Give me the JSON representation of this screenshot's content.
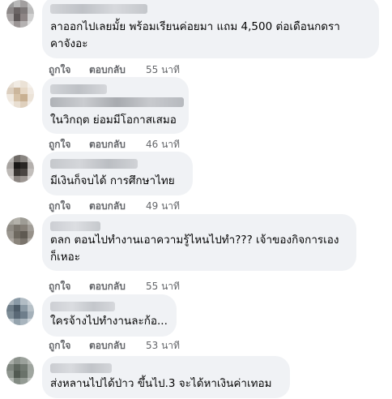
{
  "comments": [
    {
      "text_lines": [
        "ลาออกไปเลยมั้ย พร้อมเรียนค่อยมา แถม 4,500 ต่อเดือนกดรา",
        "คาจังอะ"
      ],
      "like": "ถูกใจ",
      "reply": "ตอบกลับ",
      "time": "55 นาที"
    },
    {
      "text_lines": [
        "ในวิกฤต ย่อมมีโอกาสเสมอ"
      ],
      "like": "ถูกใจ",
      "reply": "ตอบกลับ",
      "time": "46 นาที"
    },
    {
      "text_lines": [
        "มีเงินก็จบได้ การศึกษาไทย"
      ],
      "like": "ถูกใจ",
      "reply": "ตอบกลับ",
      "time": "49 นาที"
    },
    {
      "text_lines": [
        "ตลก ตอนไปทำงานเอาความรู้ไหนไปทำ??? เจ้าของกิจการเอง",
        "ก็เหอะ"
      ],
      "like": "ถูกใจ",
      "reply": "ตอบกลับ",
      "time": "55 นาที"
    },
    {
      "text_lines": [
        "ใครจ้างไปทำงานละก้อ..."
      ],
      "like": "ถูกใจ",
      "reply": "ตอบกลับ",
      "time": "53 นาที"
    },
    {
      "text_lines": [
        "ส่งหลานไปได้ป่าว ขึ้นไป.3 จะได้หาเงินค่าเทอม"
      ],
      "like": "",
      "reply": "",
      "time": ""
    }
  ],
  "colors": {
    "bubble": "#f0f2f5",
    "meta_text": "#65676b",
    "body_text": "#050505"
  }
}
